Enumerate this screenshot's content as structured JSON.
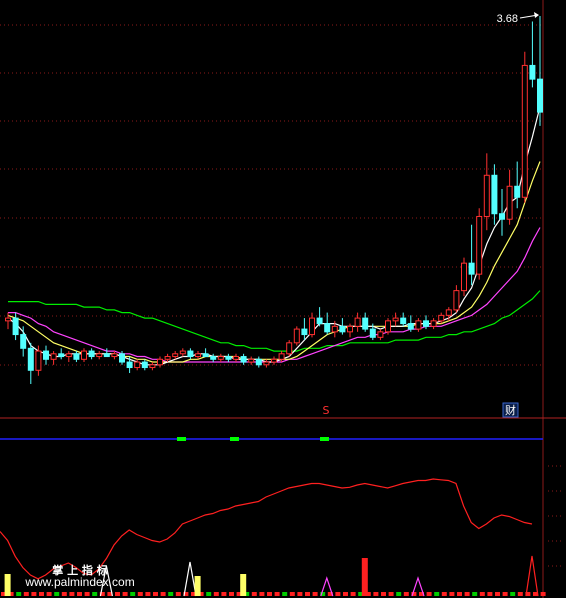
{
  "price_label": "3.68",
  "markers": {
    "s_marker": "S",
    "cai_marker": "财"
  },
  "watermark": {
    "line1": "掌 上 指 标",
    "line2": "www.palmindex.com"
  },
  "colors": {
    "background": "#000000",
    "grid": "#8b1a1a",
    "separator": "#b22222",
    "up": "#ff3030",
    "down": "#54ffff",
    "ma_short": "#ffffff",
    "ma_mid": "#ffff66",
    "ma_long": "#ff44ff",
    "ma_longest": "#00ee00",
    "indicator": "#ff2020",
    "band": "#2020ff",
    "band_mark": "#00ff00"
  },
  "chart_data": [
    {
      "type": "candlestick",
      "title": "",
      "xlabel": "",
      "ylabel": "",
      "annotation": "3.68",
      "candles": [
        {
          "o": 2.57,
          "h": 2.6,
          "l": 2.54,
          "c": 2.58
        },
        {
          "o": 2.58,
          "h": 2.6,
          "l": 2.5,
          "c": 2.52
        },
        {
          "o": 2.52,
          "h": 2.55,
          "l": 2.44,
          "c": 2.47
        },
        {
          "o": 2.47,
          "h": 2.49,
          "l": 2.34,
          "c": 2.39
        },
        {
          "o": 2.39,
          "h": 2.48,
          "l": 2.37,
          "c": 2.46
        },
        {
          "o": 2.46,
          "h": 2.48,
          "l": 2.41,
          "c": 2.43
        },
        {
          "o": 2.43,
          "h": 2.46,
          "l": 2.41,
          "c": 2.45
        },
        {
          "o": 2.45,
          "h": 2.47,
          "l": 2.43,
          "c": 2.44
        },
        {
          "o": 2.44,
          "h": 2.46,
          "l": 2.42,
          "c": 2.45
        },
        {
          "o": 2.45,
          "h": 2.46,
          "l": 2.42,
          "c": 2.43
        },
        {
          "o": 2.43,
          "h": 2.47,
          "l": 2.42,
          "c": 2.46
        },
        {
          "o": 2.46,
          "h": 2.47,
          "l": 2.43,
          "c": 2.44
        },
        {
          "o": 2.44,
          "h": 2.46,
          "l": 2.43,
          "c": 2.45
        },
        {
          "o": 2.45,
          "h": 2.47,
          "l": 2.44,
          "c": 2.44
        },
        {
          "o": 2.44,
          "h": 2.46,
          "l": 2.43,
          "c": 2.45
        },
        {
          "o": 2.45,
          "h": 2.46,
          "l": 2.41,
          "c": 2.42
        },
        {
          "o": 2.42,
          "h": 2.44,
          "l": 2.38,
          "c": 2.4
        },
        {
          "o": 2.4,
          "h": 2.43,
          "l": 2.39,
          "c": 2.42
        },
        {
          "o": 2.42,
          "h": 2.43,
          "l": 2.39,
          "c": 2.4
        },
        {
          "o": 2.4,
          "h": 2.42,
          "l": 2.39,
          "c": 2.41
        },
        {
          "o": 2.41,
          "h": 2.44,
          "l": 2.4,
          "c": 2.43
        },
        {
          "o": 2.43,
          "h": 2.45,
          "l": 2.42,
          "c": 2.44
        },
        {
          "o": 2.44,
          "h": 2.46,
          "l": 2.43,
          "c": 2.45
        },
        {
          "o": 2.45,
          "h": 2.47,
          "l": 2.44,
          "c": 2.46
        },
        {
          "o": 2.46,
          "h": 2.47,
          "l": 2.43,
          "c": 2.44
        },
        {
          "o": 2.44,
          "h": 2.46,
          "l": 2.43,
          "c": 2.45
        },
        {
          "o": 2.45,
          "h": 2.47,
          "l": 2.44,
          "c": 2.44
        },
        {
          "o": 2.44,
          "h": 2.45,
          "l": 2.42,
          "c": 2.43
        },
        {
          "o": 2.43,
          "h": 2.45,
          "l": 2.42,
          "c": 2.44
        },
        {
          "o": 2.44,
          "h": 2.45,
          "l": 2.42,
          "c": 2.43
        },
        {
          "o": 2.43,
          "h": 2.45,
          "l": 2.42,
          "c": 2.44
        },
        {
          "o": 2.44,
          "h": 2.45,
          "l": 2.41,
          "c": 2.42
        },
        {
          "o": 2.42,
          "h": 2.44,
          "l": 2.41,
          "c": 2.43
        },
        {
          "o": 2.43,
          "h": 2.44,
          "l": 2.4,
          "c": 2.41
        },
        {
          "o": 2.41,
          "h": 2.43,
          "l": 2.4,
          "c": 2.42
        },
        {
          "o": 2.42,
          "h": 2.44,
          "l": 2.41,
          "c": 2.43
        },
        {
          "o": 2.43,
          "h": 2.46,
          "l": 2.42,
          "c": 2.45
        },
        {
          "o": 2.45,
          "h": 2.5,
          "l": 2.44,
          "c": 2.49
        },
        {
          "o": 2.49,
          "h": 2.55,
          "l": 2.48,
          "c": 2.54
        },
        {
          "o": 2.54,
          "h": 2.58,
          "l": 2.5,
          "c": 2.52
        },
        {
          "o": 2.52,
          "h": 2.6,
          "l": 2.51,
          "c": 2.58
        },
        {
          "o": 2.58,
          "h": 2.62,
          "l": 2.55,
          "c": 2.56
        },
        {
          "o": 2.56,
          "h": 2.6,
          "l": 2.52,
          "c": 2.53
        },
        {
          "o": 2.53,
          "h": 2.57,
          "l": 2.51,
          "c": 2.55
        },
        {
          "o": 2.55,
          "h": 2.58,
          "l": 2.52,
          "c": 2.53
        },
        {
          "o": 2.53,
          "h": 2.56,
          "l": 2.51,
          "c": 2.55
        },
        {
          "o": 2.55,
          "h": 2.6,
          "l": 2.53,
          "c": 2.58
        },
        {
          "o": 2.58,
          "h": 2.6,
          "l": 2.53,
          "c": 2.54
        },
        {
          "o": 2.54,
          "h": 2.56,
          "l": 2.5,
          "c": 2.51
        },
        {
          "o": 2.51,
          "h": 2.54,
          "l": 2.5,
          "c": 2.53
        },
        {
          "o": 2.53,
          "h": 2.58,
          "l": 2.52,
          "c": 2.57
        },
        {
          "o": 2.57,
          "h": 2.6,
          "l": 2.55,
          "c": 2.58
        },
        {
          "o": 2.58,
          "h": 2.6,
          "l": 2.55,
          "c": 2.56
        },
        {
          "o": 2.56,
          "h": 2.59,
          "l": 2.53,
          "c": 2.54
        },
        {
          "o": 2.54,
          "h": 2.58,
          "l": 2.53,
          "c": 2.57
        },
        {
          "o": 2.57,
          "h": 2.59,
          "l": 2.54,
          "c": 2.55
        },
        {
          "o": 2.55,
          "h": 2.58,
          "l": 2.54,
          "c": 2.57
        },
        {
          "o": 2.57,
          "h": 2.6,
          "l": 2.56,
          "c": 2.59
        },
        {
          "o": 2.59,
          "h": 2.62,
          "l": 2.57,
          "c": 2.61
        },
        {
          "o": 2.61,
          "h": 2.7,
          "l": 2.6,
          "c": 2.68
        },
        {
          "o": 2.68,
          "h": 2.8,
          "l": 2.66,
          "c": 2.78
        },
        {
          "o": 2.78,
          "h": 2.92,
          "l": 2.7,
          "c": 2.74
        },
        {
          "o": 2.74,
          "h": 2.98,
          "l": 2.72,
          "c": 2.95
        },
        {
          "o": 2.95,
          "h": 3.18,
          "l": 2.9,
          "c": 3.1
        },
        {
          "o": 3.1,
          "h": 3.14,
          "l": 2.92,
          "c": 2.96
        },
        {
          "o": 2.96,
          "h": 3.05,
          "l": 2.88,
          "c": 2.94
        },
        {
          "o": 2.94,
          "h": 3.12,
          "l": 2.92,
          "c": 3.06
        },
        {
          "o": 3.06,
          "h": 3.15,
          "l": 2.98,
          "c": 3.02
        },
        {
          "o": 3.02,
          "h": 3.55,
          "l": 3.0,
          "c": 3.5
        },
        {
          "o": 3.5,
          "h": 3.66,
          "l": 3.42,
          "c": 3.45
        },
        {
          "o": 3.45,
          "h": 3.68,
          "l": 3.28,
          "c": 3.33
        }
      ],
      "ma_short": [
        2.58,
        2.56,
        2.53,
        2.48,
        2.46,
        2.45,
        2.44,
        2.44,
        2.45,
        2.45,
        2.45,
        2.45,
        2.45,
        2.45,
        2.45,
        2.44,
        2.43,
        2.42,
        2.41,
        2.41,
        2.41,
        2.42,
        2.43,
        2.44,
        2.44,
        2.45,
        2.45,
        2.44,
        2.44,
        2.44,
        2.43,
        2.43,
        2.43,
        2.43,
        2.42,
        2.42,
        2.43,
        2.44,
        2.47,
        2.5,
        2.53,
        2.56,
        2.56,
        2.56,
        2.55,
        2.55,
        2.55,
        2.55,
        2.55,
        2.54,
        2.55,
        2.55,
        2.55,
        2.56,
        2.56,
        2.56,
        2.56,
        2.57,
        2.58,
        2.6,
        2.65,
        2.69,
        2.77,
        2.85,
        2.91,
        2.95,
        3.0,
        3.02,
        3.14,
        3.24,
        3.35
      ],
      "ma_mid": [
        2.59,
        2.58,
        2.57,
        2.55,
        2.53,
        2.51,
        2.49,
        2.48,
        2.47,
        2.46,
        2.45,
        2.45,
        2.45,
        2.45,
        2.45,
        2.44,
        2.44,
        2.43,
        2.43,
        2.42,
        2.42,
        2.42,
        2.42,
        2.42,
        2.43,
        2.43,
        2.44,
        2.44,
        2.44,
        2.44,
        2.44,
        2.43,
        2.43,
        2.43,
        2.43,
        2.43,
        2.43,
        2.43,
        2.44,
        2.46,
        2.48,
        2.5,
        2.52,
        2.53,
        2.54,
        2.55,
        2.55,
        2.55,
        2.55,
        2.55,
        2.55,
        2.55,
        2.55,
        2.55,
        2.56,
        2.56,
        2.56,
        2.56,
        2.57,
        2.58,
        2.6,
        2.62,
        2.66,
        2.71,
        2.77,
        2.82,
        2.87,
        2.92,
        3.0,
        3.08,
        3.15
      ],
      "ma_long": [
        2.6,
        2.6,
        2.59,
        2.58,
        2.56,
        2.55,
        2.53,
        2.52,
        2.51,
        2.5,
        2.49,
        2.48,
        2.47,
        2.46,
        2.46,
        2.45,
        2.45,
        2.44,
        2.44,
        2.43,
        2.43,
        2.42,
        2.42,
        2.42,
        2.42,
        2.42,
        2.42,
        2.42,
        2.42,
        2.42,
        2.42,
        2.42,
        2.42,
        2.42,
        2.42,
        2.42,
        2.42,
        2.43,
        2.43,
        2.44,
        2.45,
        2.46,
        2.47,
        2.48,
        2.49,
        2.5,
        2.51,
        2.51,
        2.52,
        2.52,
        2.53,
        2.53,
        2.53,
        2.54,
        2.54,
        2.55,
        2.55,
        2.55,
        2.56,
        2.57,
        2.58,
        2.59,
        2.61,
        2.63,
        2.66,
        2.69,
        2.72,
        2.75,
        2.8,
        2.86,
        2.91
      ],
      "ma_longest": [
        2.64,
        2.64,
        2.64,
        2.64,
        2.64,
        2.63,
        2.63,
        2.63,
        2.63,
        2.63,
        2.62,
        2.62,
        2.62,
        2.61,
        2.61,
        2.6,
        2.6,
        2.59,
        2.58,
        2.58,
        2.57,
        2.56,
        2.55,
        2.54,
        2.53,
        2.52,
        2.51,
        2.5,
        2.49,
        2.49,
        2.48,
        2.48,
        2.47,
        2.47,
        2.47,
        2.46,
        2.46,
        2.46,
        2.46,
        2.47,
        2.47,
        2.47,
        2.48,
        2.48,
        2.48,
        2.49,
        2.49,
        2.49,
        2.49,
        2.49,
        2.49,
        2.5,
        2.5,
        2.5,
        2.5,
        2.51,
        2.51,
        2.51,
        2.52,
        2.52,
        2.53,
        2.53,
        2.54,
        2.55,
        2.56,
        2.58,
        2.59,
        2.61,
        2.63,
        2.65,
        2.68
      ]
    },
    {
      "type": "line",
      "title": "",
      "xlabel": "",
      "ylabel": "",
      "series": [
        {
          "values": [
            78,
            66,
            45,
            30,
            20,
            15,
            20,
            28,
            32,
            36,
            30,
            22,
            20,
            28,
            42,
            60,
            72,
            80,
            74,
            70,
            66,
            64,
            68,
            76,
            88,
            92,
            96,
            100,
            102,
            106,
            108,
            112,
            114,
            116,
            118,
            124,
            128,
            132,
            136,
            138,
            140,
            142,
            142,
            140,
            138,
            136,
            137,
            140,
            142,
            140,
            138,
            136,
            139,
            142,
            144,
            146,
            146,
            148,
            147,
            146,
            142,
            112,
            90,
            82,
            88,
            96,
            100,
            98,
            94,
            90,
            88
          ]
        }
      ],
      "signal_spikes": [
        {
          "index": 1,
          "color": "#ffff66",
          "height": 22
        },
        {
          "index": 14,
          "color": "#ffffff",
          "height": 30
        },
        {
          "index": 25,
          "color": "#ffffff",
          "height": 34
        },
        {
          "index": 26,
          "color": "#ffff66",
          "height": 20
        },
        {
          "index": 32,
          "color": "#ffff66",
          "height": 22
        },
        {
          "index": 43,
          "color": "#ff44ff",
          "height": 18
        },
        {
          "index": 48,
          "color": "#ff2020",
          "height": 38
        },
        {
          "index": 55,
          "color": "#ff44ff",
          "height": 18
        },
        {
          "index": 70,
          "color": "#ff2020",
          "height": 40
        }
      ]
    }
  ]
}
